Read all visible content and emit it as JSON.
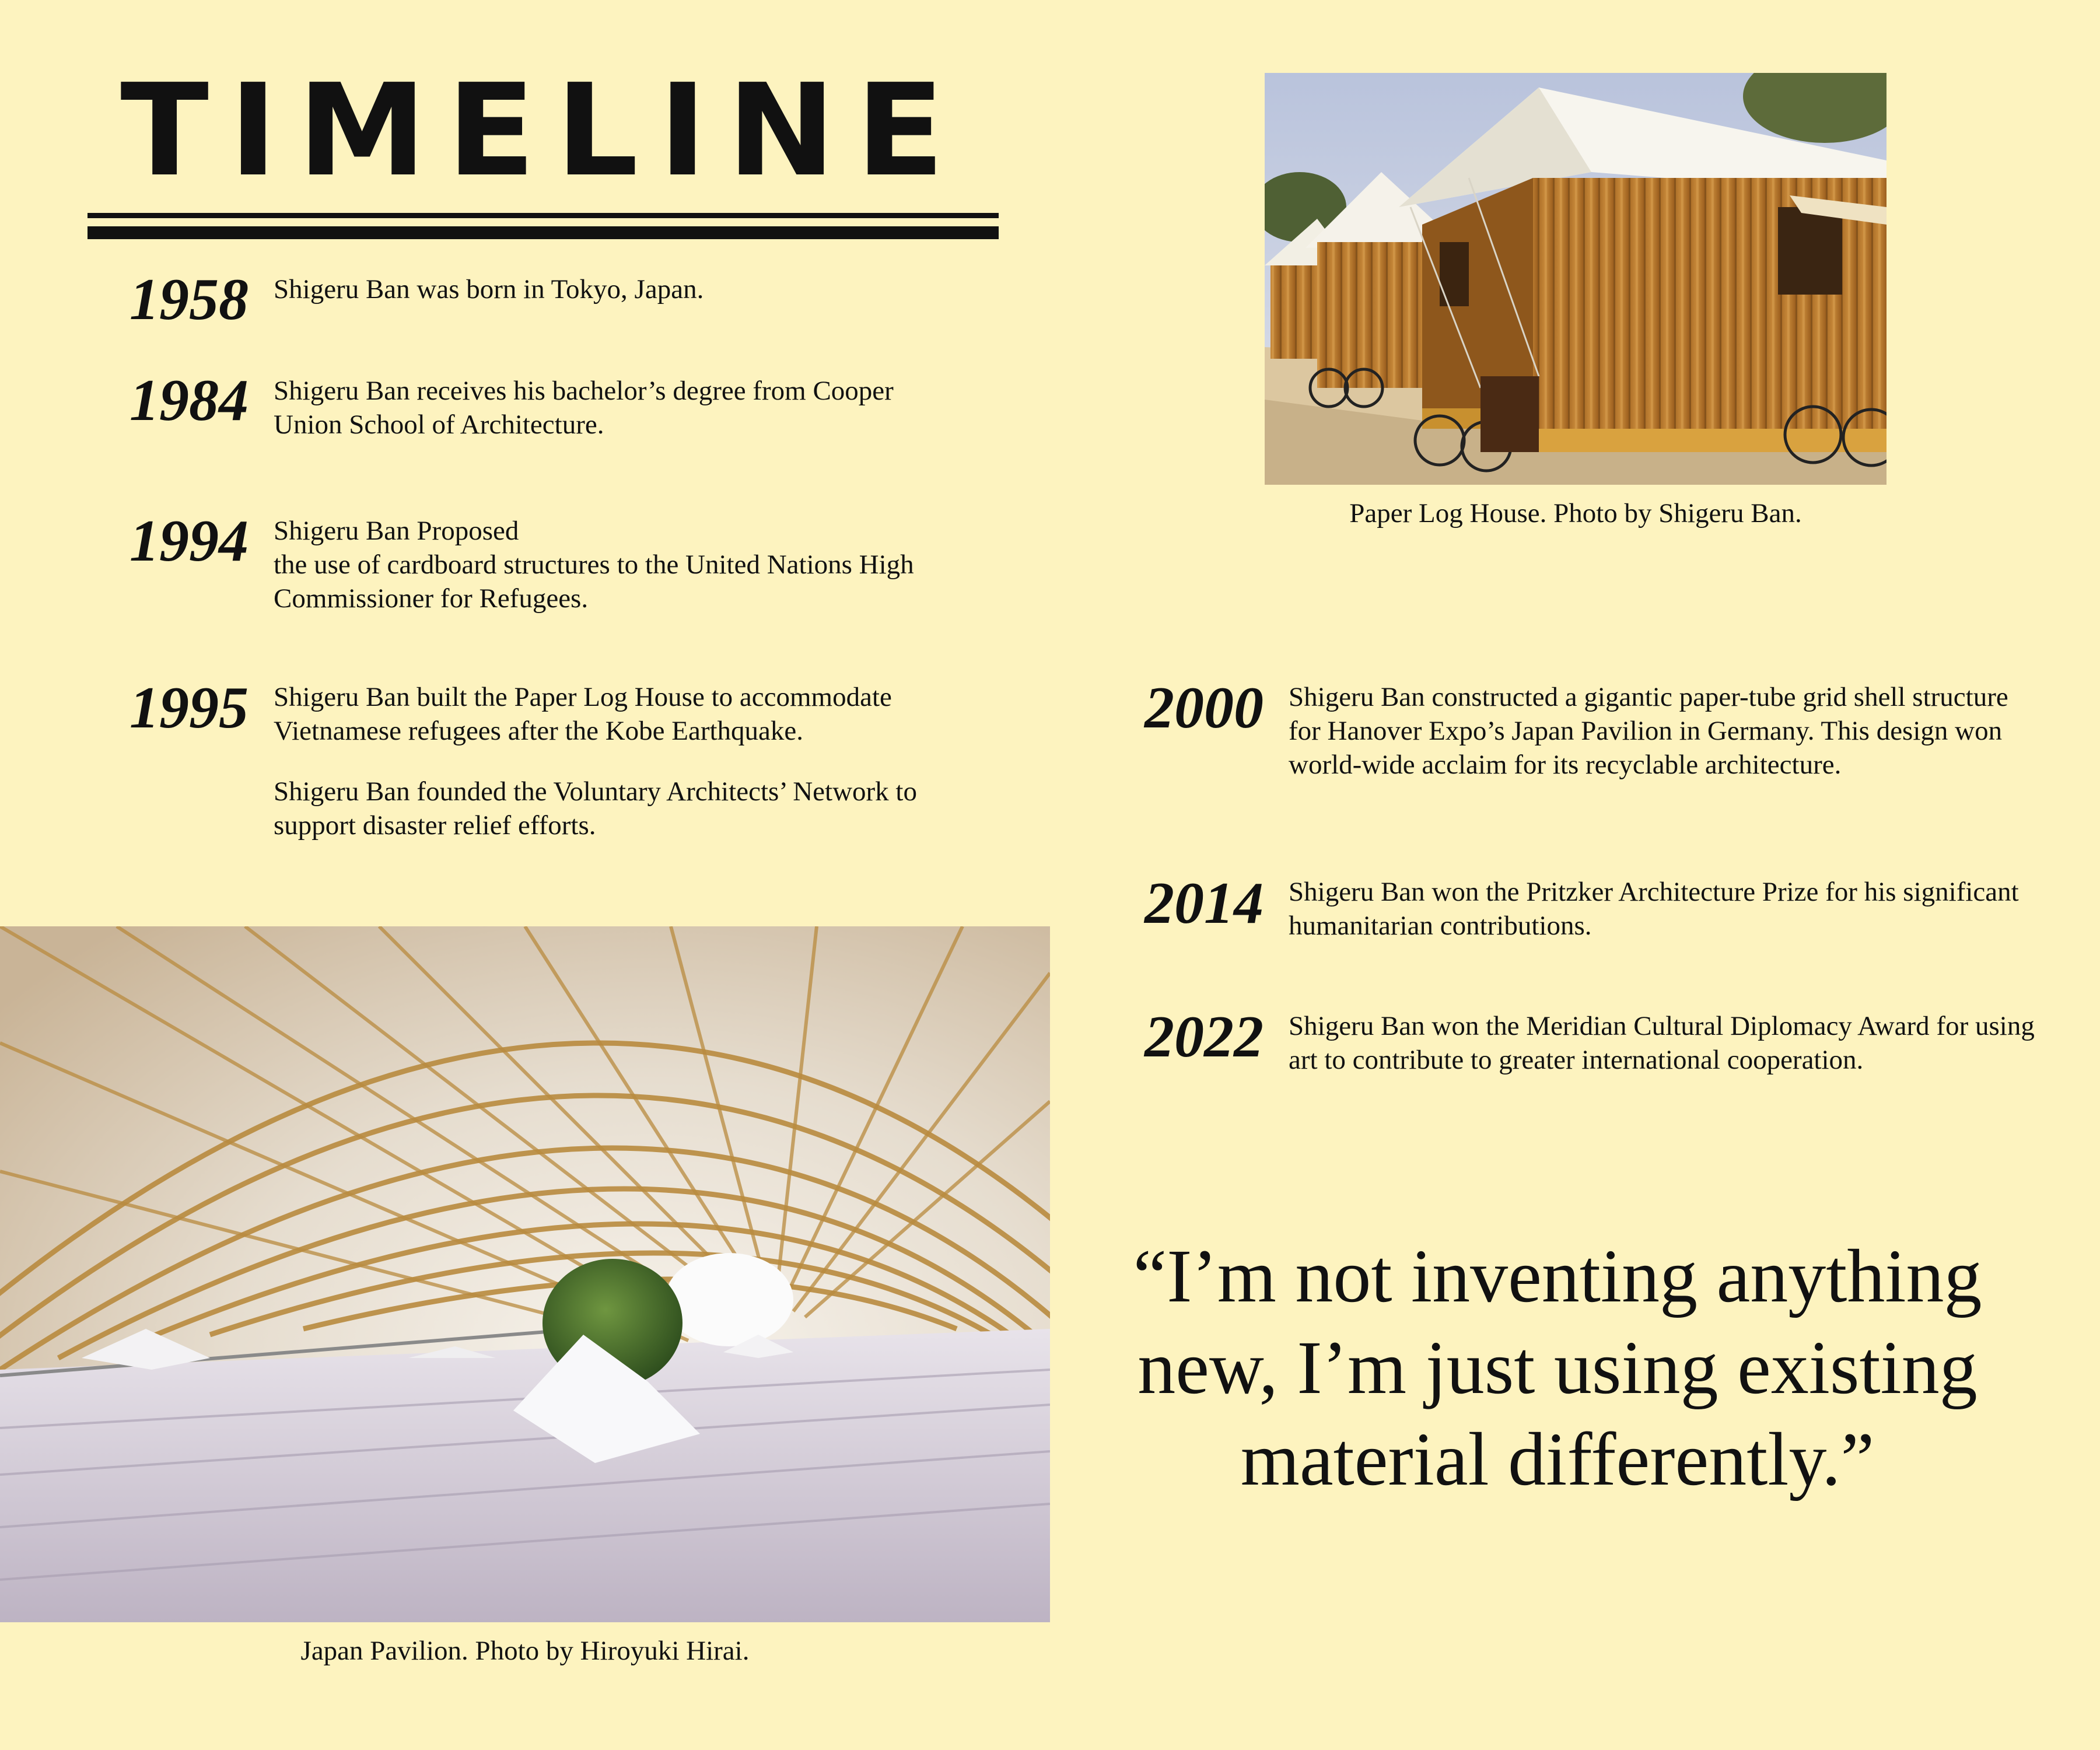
{
  "title": "TIMELINE",
  "timeline": [
    {
      "year": "1958",
      "text": "Shigeru Ban was born in Tokyo, Japan."
    },
    {
      "year": "1984",
      "text": "Shigeru Ban receives his bachelor’s degree from Cooper Union School of Architecture."
    },
    {
      "year": "1994",
      "text_line1": "Shigeru Ban Proposed",
      "text_line2": "the use of cardboard structures to the United Nations High Commissioner for Refugees."
    },
    {
      "year": "1995",
      "text": "Shigeru Ban built the Paper Log House to accommodate Vietnamese refugees after the Kobe Earthquake.",
      "text_extra": "Shigeru Ban founded the Voluntary Architects’ Network to support disaster relief efforts."
    },
    {
      "year": "2000",
      "text": "Shigeru Ban constructed a gigantic paper-tube grid shell structure for Hanover Expo’s Japan Pavilion in Germany. This design won world-wide acclaim for its recyclable architecture."
    },
    {
      "year": "2014",
      "text": "Shigeru Ban won the Pritzker Architecture Prize for his significant humanitarian contributions."
    },
    {
      "year": "2022",
      "text": "Shigeru Ban won the Meridian Cultural Diplomacy Award for using art to contribute to greater international cooperation."
    }
  ],
  "photos": {
    "paper_log_house_caption": "Paper Log House. Photo by Shigeru Ban.",
    "japan_pavilion_caption": "Japan Pavilion. Photo by Hiroyuki Hirai."
  },
  "quote": "“I’m not inventing anything new, I’m just using existing material differently.”",
  "colors": {
    "background": "#fdf3bf",
    "text": "#111111"
  }
}
